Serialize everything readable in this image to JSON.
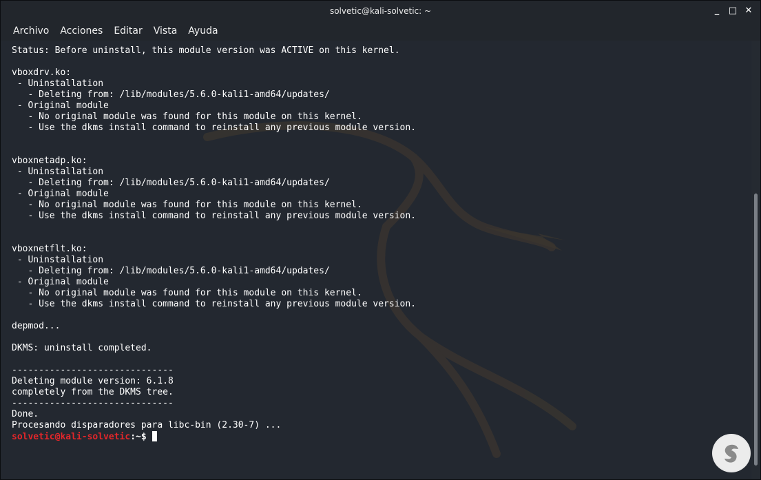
{
  "window": {
    "title": "solvetic@kali-solvetic: ~",
    "controls": {
      "minimize": "_",
      "maximize": "□",
      "close": "✕"
    }
  },
  "menu": [
    "Archivo",
    "Acciones",
    "Editar",
    "Vista",
    "Ayuda"
  ],
  "terminal": {
    "lines": [
      "Status: Before uninstall, this module version was ACTIVE on this kernel.",
      "",
      "vboxdrv.ko:",
      " - Uninstallation",
      "   - Deleting from: /lib/modules/5.6.0-kali1-amd64/updates/",
      " - Original module",
      "   - No original module was found for this module on this kernel.",
      "   - Use the dkms install command to reinstall any previous module version.",
      "",
      "",
      "vboxnetadp.ko:",
      " - Uninstallation",
      "   - Deleting from: /lib/modules/5.6.0-kali1-amd64/updates/",
      " - Original module",
      "   - No original module was found for this module on this kernel.",
      "   - Use the dkms install command to reinstall any previous module version.",
      "",
      "",
      "vboxnetflt.ko:",
      " - Uninstallation",
      "   - Deleting from: /lib/modules/5.6.0-kali1-amd64/updates/",
      " - Original module",
      "   - No original module was found for this module on this kernel.",
      "   - Use the dkms install command to reinstall any previous module version.",
      "",
      "depmod...",
      "",
      "DKMS: uninstall completed.",
      "",
      "------------------------------",
      "Deleting module version: 6.1.8",
      "completely from the DKMS tree.",
      "------------------------------",
      "Done.",
      "Procesando disparadores para libc-bin (2.30-7) ..."
    ],
    "prompt": {
      "user_host": "solvetic@kali-solvetic",
      "path": ":~",
      "symbol": "$ "
    }
  },
  "colors": {
    "terminal_bg": "#232830",
    "prompt_user": "#e4262a",
    "text": "#ffffff"
  },
  "icons": [
    "dragon-watermark-icon",
    "watermark-logo-icon"
  ]
}
